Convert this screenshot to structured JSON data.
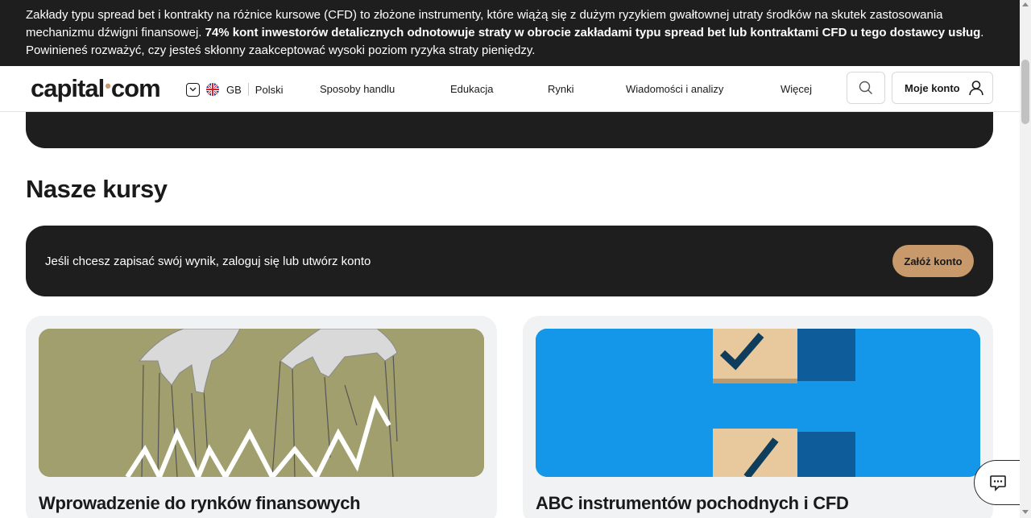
{
  "risk_banner": {
    "text_before": "Zakłady typu spread bet i kontrakty na różnice kursowe (CFD) to złożone instrumenty, które wiążą się z dużym ryzykiem gwałtownej utraty środków na skutek zastosowania mechanizmu dźwigni finansowej. ",
    "text_bold": "74% kont inwestorów detalicznych odnotowuje straty w obrocie zakładami typu spread bet lub kontraktami CFD u tego dostawcy usług",
    "text_after": ". Powinieneś rozważyć, czy jesteś skłonny zaakceptować wysoki poziom ryzyka straty pieniędzy."
  },
  "header": {
    "logo_left": "capital",
    "logo_dot": "•",
    "logo_right": "com",
    "region": "GB",
    "language": "Polski",
    "nav": [
      "Sposoby handlu",
      "Edukacja",
      "Rynki",
      "Wiadomości i analizy",
      "Więcej"
    ],
    "account_label": "Moje konto"
  },
  "main": {
    "section_title": "Nasze kursy",
    "cta_text": "Jeśli chcesz zapisać swój wynik, zaloguj się lub utwórz konto",
    "cta_button": "Załóż konto",
    "cards": [
      {
        "title": "Wprowadzenie do rynków finansowych"
      },
      {
        "title": "ABC instrumentów pochodnych i CFD"
      }
    ]
  },
  "colors": {
    "dark": "#1e1e1e",
    "accent": "#c8996a",
    "card_bg": "#f1f2f3",
    "olive": "#a19f6e",
    "blue": "#1597e9"
  },
  "icons": [
    "chevron-down-icon",
    "uk-flag-icon",
    "search-icon",
    "user-icon",
    "chat-icon"
  ]
}
